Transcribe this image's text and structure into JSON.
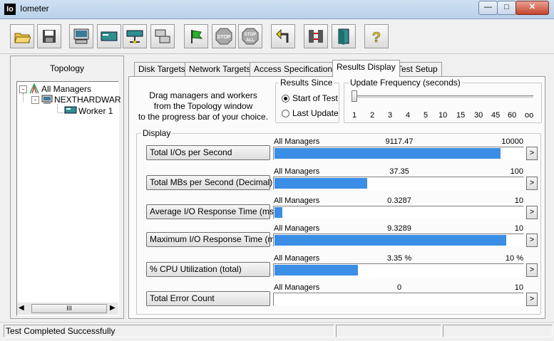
{
  "window": {
    "title": "Iometer",
    "icon_text": "Io"
  },
  "toolbar": {
    "buttons": [
      {
        "name": "open-icon"
      },
      {
        "name": "save-icon"
      },
      {
        "name": "new-manager-icon"
      },
      {
        "name": "new-disk-worker-icon"
      },
      {
        "name": "new-network-worker-icon"
      },
      {
        "name": "duplicate-worker-icon"
      },
      {
        "name": "start-icon"
      },
      {
        "name": "stop-icon",
        "label": "STOP"
      },
      {
        "name": "stop-all-icon",
        "label": "STOP ALL"
      },
      {
        "name": "reset-icon"
      },
      {
        "name": "disconnect-icon"
      },
      {
        "name": "exit-icon"
      },
      {
        "name": "help-icon",
        "label": "?"
      }
    ]
  },
  "topology": {
    "title": "Topology",
    "tree": [
      {
        "label": "All Managers"
      },
      {
        "label": "NEXTHARDWAR"
      },
      {
        "label": "Worker 1"
      }
    ],
    "scroll_thumb": "III"
  },
  "tabs": [
    "Disk Targets",
    "Network Targets",
    "Access Specifications",
    "Results Display",
    "Test Setup"
  ],
  "active_tab": "Results Display",
  "instructions": [
    "Drag managers and workers",
    "from the Topology window",
    "to the progress bar of your choice."
  ],
  "results_since": {
    "label": "Results Since",
    "options": [
      "Start of Test",
      "Last Update"
    ],
    "selected": "Start of Test"
  },
  "update_frequency": {
    "label": "Update Frequency (seconds)",
    "ticks": [
      "1",
      "2",
      "3",
      "4",
      "5",
      "10",
      "15",
      "30",
      "45",
      "60",
      "oo"
    ],
    "selected": "1"
  },
  "display": {
    "label": "Display",
    "rows": [
      {
        "button": "Total I/Os per Second",
        "source": "All Managers",
        "value": "9117.47",
        "max": "10000",
        "fraction": 0.9117
      },
      {
        "button": "Total MBs per Second (Decimal)",
        "source": "All Managers",
        "value": "37.35",
        "max": "100",
        "fraction": 0.3735
      },
      {
        "button": "Average I/O Response Time (ms)",
        "source": "All Managers",
        "value": "0.3287",
        "max": "10",
        "fraction": 0.0329
      },
      {
        "button": "Maximum I/O Response Time (ms)",
        "source": "All Managers",
        "value": "9.3289",
        "max": "10",
        "fraction": 0.9329
      },
      {
        "button": "% CPU Utilization (total)",
        "source": "All Managers",
        "value": "3.35 %",
        "max": "10 %",
        "fraction": 0.335
      },
      {
        "button": "Total Error Count",
        "source": "All Managers",
        "value": "0",
        "max": "10",
        "fraction": 0
      }
    ]
  },
  "status": {
    "text": "Test Completed Successfully"
  },
  "colors": {
    "bar": "#3a8ee6"
  }
}
